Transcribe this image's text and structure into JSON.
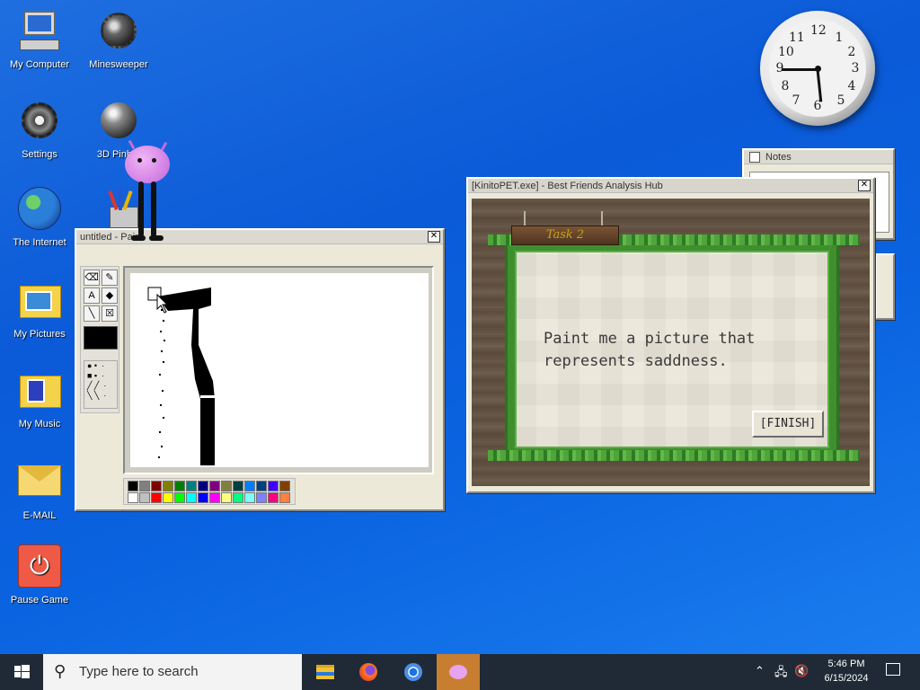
{
  "desktop_icons": [
    {
      "id": "my-computer",
      "label": "My Computer",
      "icon": "computer-icon"
    },
    {
      "id": "minesweeper",
      "label": "Minesweeper",
      "icon": "mine-icon"
    },
    {
      "id": "settings",
      "label": "Settings",
      "icon": "gear-icon"
    },
    {
      "id": "3d-pinball",
      "label": "3D Pinb...",
      "icon": "pinball-icon"
    },
    {
      "id": "the-internet",
      "label": "The Internet",
      "icon": "globe-icon"
    },
    {
      "id": "paint",
      "label": "Paint",
      "icon": "paint-icon"
    },
    {
      "id": "my-pictures",
      "label": "My Pictures",
      "icon": "pictures-folder-icon"
    },
    {
      "id": "my-music",
      "label": "My Music",
      "icon": "music-folder-icon"
    },
    {
      "id": "e-mail",
      "label": "E-MAIL",
      "icon": "envelope-icon"
    },
    {
      "id": "pause-game",
      "label": "Pause Game",
      "icon": "power-icon"
    }
  ],
  "clock": {
    "numbers": [
      "12",
      "1",
      "2",
      "3",
      "4",
      "5",
      "6",
      "7",
      "8",
      "9",
      "10",
      "11"
    ]
  },
  "paint_window": {
    "title": "untitled - Paint",
    "close": "✕"
  },
  "notes_window": {
    "title": "Notes"
  },
  "hub_window": {
    "title": "[KinitoPET.exe] - Best Friends Analysis Hub",
    "close": "✕",
    "sign": "Task 2",
    "prompt": "Paint me a picture that represents saddness.",
    "finish_label": "[FINISH]"
  },
  "taskbar": {
    "search_placeholder": "Type here to search",
    "time": "5:46 PM",
    "date": "6/15/2024",
    "apps": [
      "file-explorer-icon",
      "firefox-icon",
      "chrome-icon",
      "kinito-icon"
    ]
  },
  "colors": {
    "desktop": "#0b5ad8",
    "leaf": "#3f8f2f",
    "sign_text": "#c9a21a",
    "pet": "#d17de2"
  },
  "palette": [
    "#000000",
    "#808080",
    "#800000",
    "#808000",
    "#008000",
    "#008080",
    "#000080",
    "#800080",
    "#808040",
    "#004040",
    "#0080ff",
    "#004080",
    "#4000ff",
    "#804000",
    "#ffffff",
    "#c0c0c0",
    "#ff0000",
    "#ffff00",
    "#00ff00",
    "#00ffff",
    "#0000ff",
    "#ff00ff",
    "#ffff80",
    "#00ff80",
    "#80ffff",
    "#8080ff",
    "#ff0080",
    "#ff8040"
  ]
}
